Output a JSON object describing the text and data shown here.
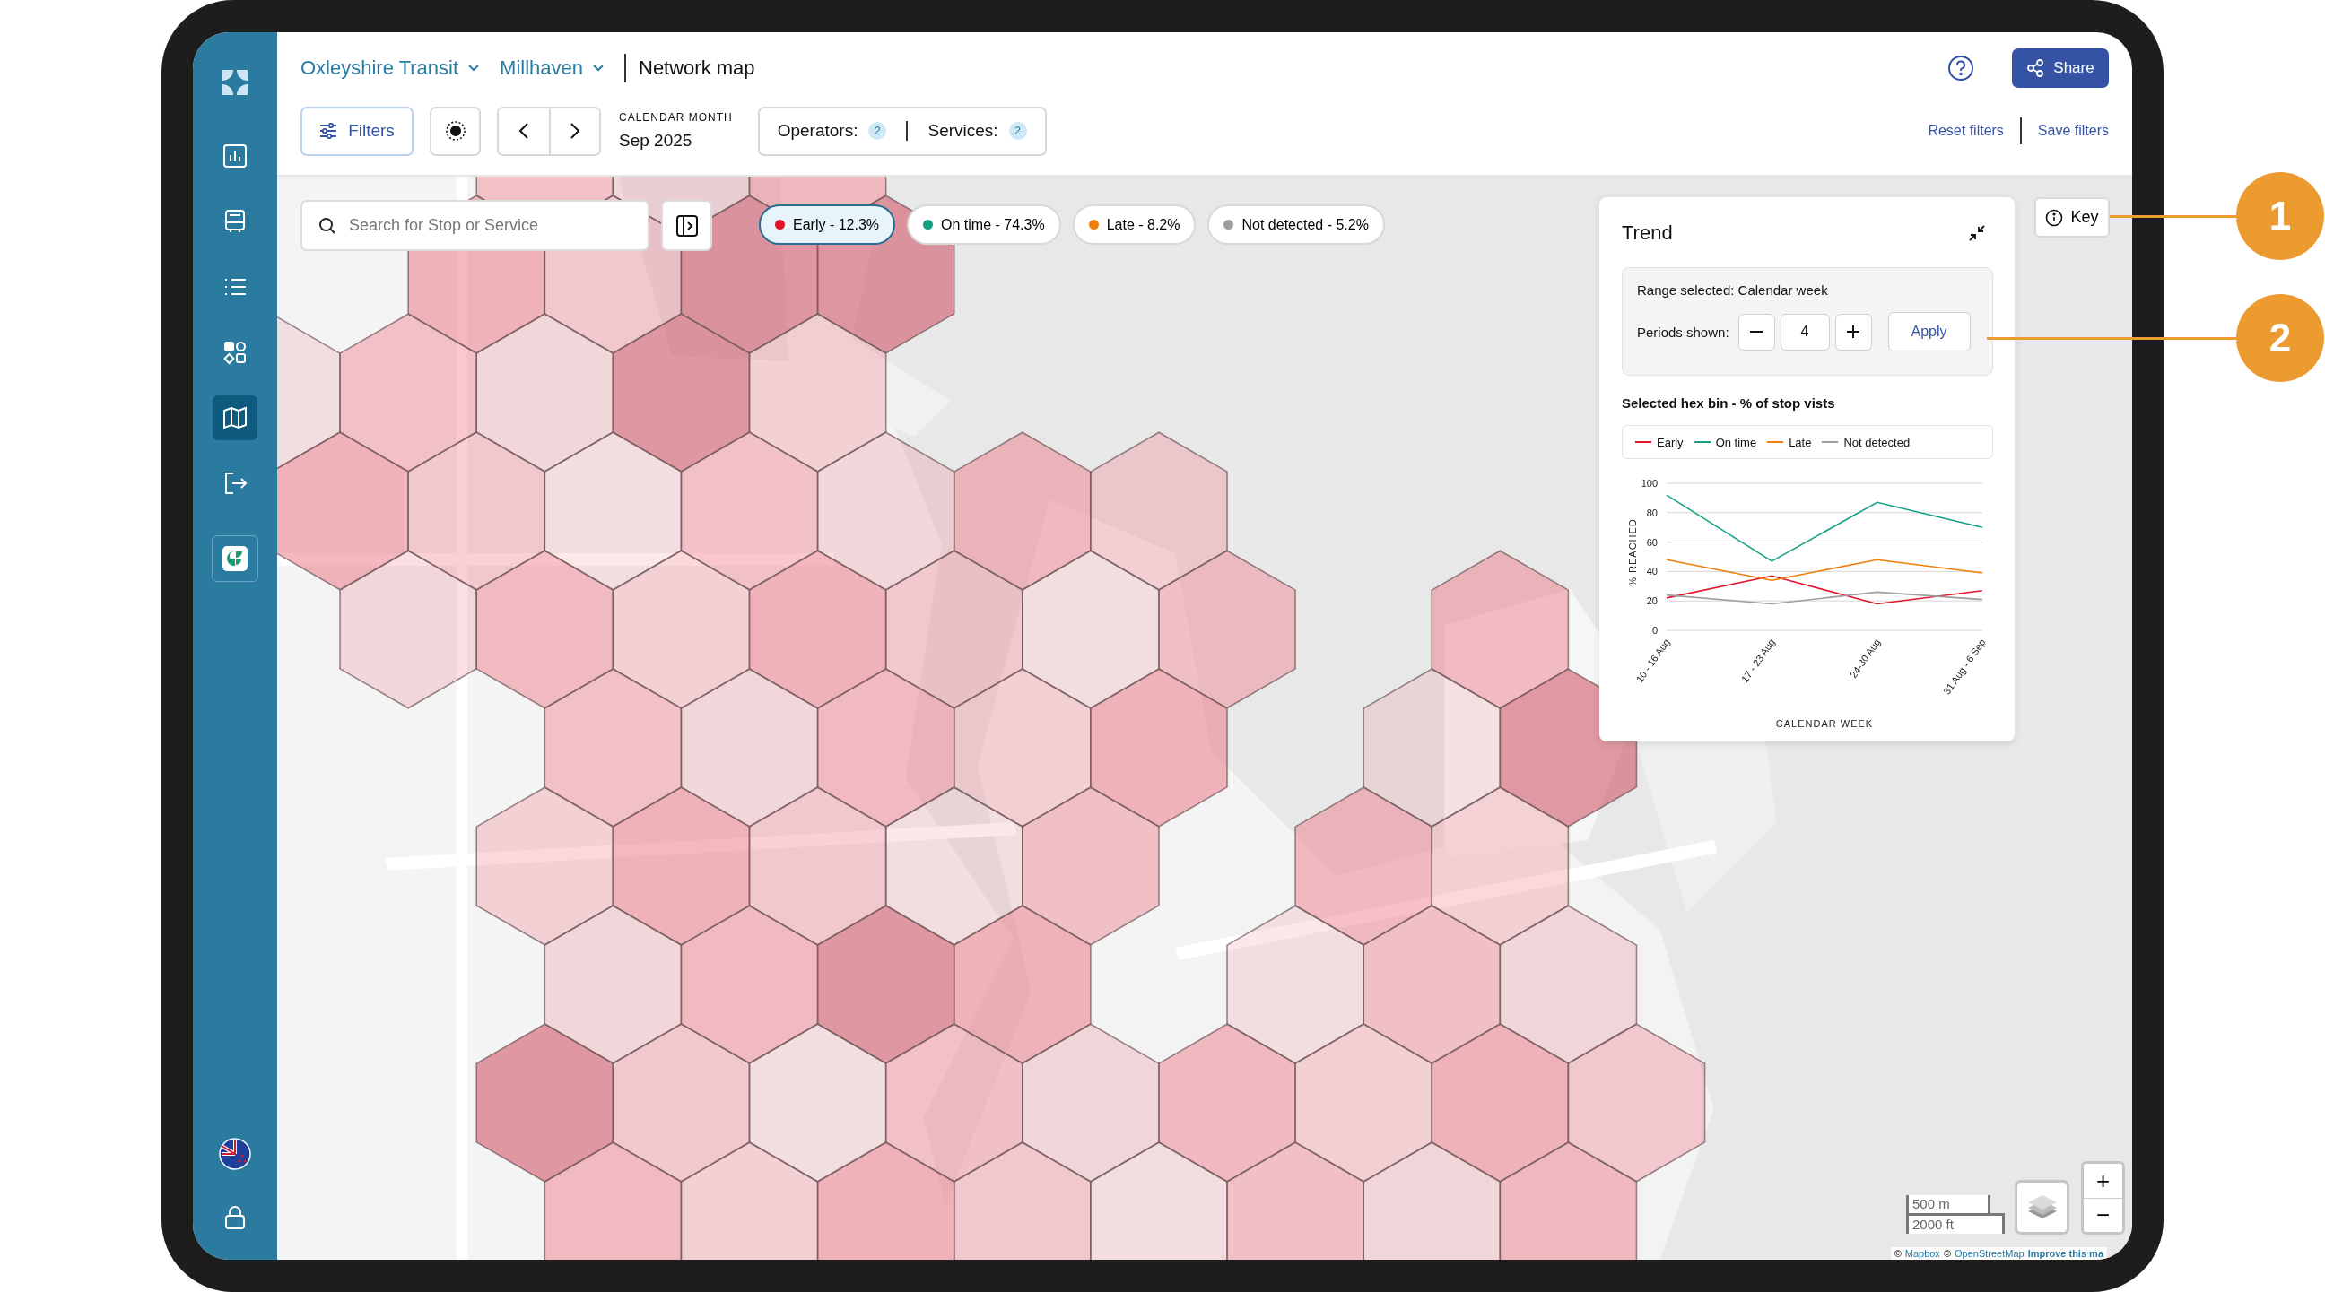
{
  "sidebar": {
    "items": [
      {
        "kind": "nav",
        "selected": false
      },
      {
        "kind": "nav",
        "selected": false
      },
      {
        "kind": "nav",
        "selected": false
      },
      {
        "kind": "nav",
        "selected": false
      },
      {
        "kind": "nav",
        "selected": true
      },
      {
        "kind": "nav",
        "selected": false
      },
      {
        "kind": "app",
        "selected": false
      }
    ]
  },
  "header": {
    "breadcrumbs": [
      "Oxleyshire Transit",
      "Millhaven"
    ],
    "page_title": "Network map",
    "share_button": "Share"
  },
  "toolbar": {
    "filters_button": "Filters",
    "period": {
      "label": "CALENDAR MONTH",
      "value": "Sep 2025"
    },
    "counts": [
      {
        "label": "Operators:",
        "count": "2"
      },
      {
        "label": "Services:",
        "count": "2"
      }
    ],
    "links": [
      "Reset filters",
      "Save filters"
    ]
  },
  "map": {
    "search": {
      "placeholder": "Search for Stop or Service"
    },
    "legend_chips": [
      {
        "label": "Early - 12.3%",
        "color": "#e0162b",
        "selected": true
      },
      {
        "label": "On time - 74.3%",
        "color": "#13a085",
        "selected": false
      },
      {
        "label": "Late - 8.2%",
        "color": "#f07d0a",
        "selected": false
      },
      {
        "label": "Not detected - 5.2%",
        "color": "#9e9e9e",
        "selected": false
      }
    ],
    "key_button": "Key",
    "scale": [
      "500 m",
      "2000 ft"
    ],
    "zoom_controls": [
      "+",
      "−"
    ],
    "attribution": {
      "copyright": [
        "©",
        "©"
      ],
      "links": [
        "Mapbox",
        "OpenStreetMap"
      ],
      "improve_link": "Improve this ma"
    }
  },
  "trend": {
    "title": "Trend",
    "range_text": "Range selected: Calendar week",
    "periods_label": "Periods shown:",
    "periods_value": "4",
    "apply_button": "Apply",
    "subtitle": "Selected hex bin - % of stop vists",
    "chart_data": {
      "type": "line",
      "xlabel": "CALENDAR WEEK",
      "ylabel": "% REACHED",
      "categories": [
        "10 - 16 Aug",
        "17 - 23 Aug",
        "24-30 Aug",
        "31 Aug - 6 Sep"
      ],
      "ylim": [
        0,
        100
      ],
      "grid": true,
      "yticks": [
        0,
        20,
        40,
        60,
        80,
        100
      ],
      "series": [
        {
          "name": "Early",
          "color": "#e0162b",
          "values": [
            22,
            37,
            18,
            27
          ]
        },
        {
          "name": "On time",
          "color": "#13a085",
          "values": [
            92,
            47,
            87,
            70
          ]
        },
        {
          "name": "Late",
          "color": "#f07d0a",
          "values": [
            48,
            34,
            48,
            39
          ]
        },
        {
          "name": "Not detected",
          "color": "#9e9e9e",
          "values": [
            24,
            18,
            26,
            21
          ]
        }
      ]
    }
  },
  "callouts": [
    "1",
    "2"
  ]
}
